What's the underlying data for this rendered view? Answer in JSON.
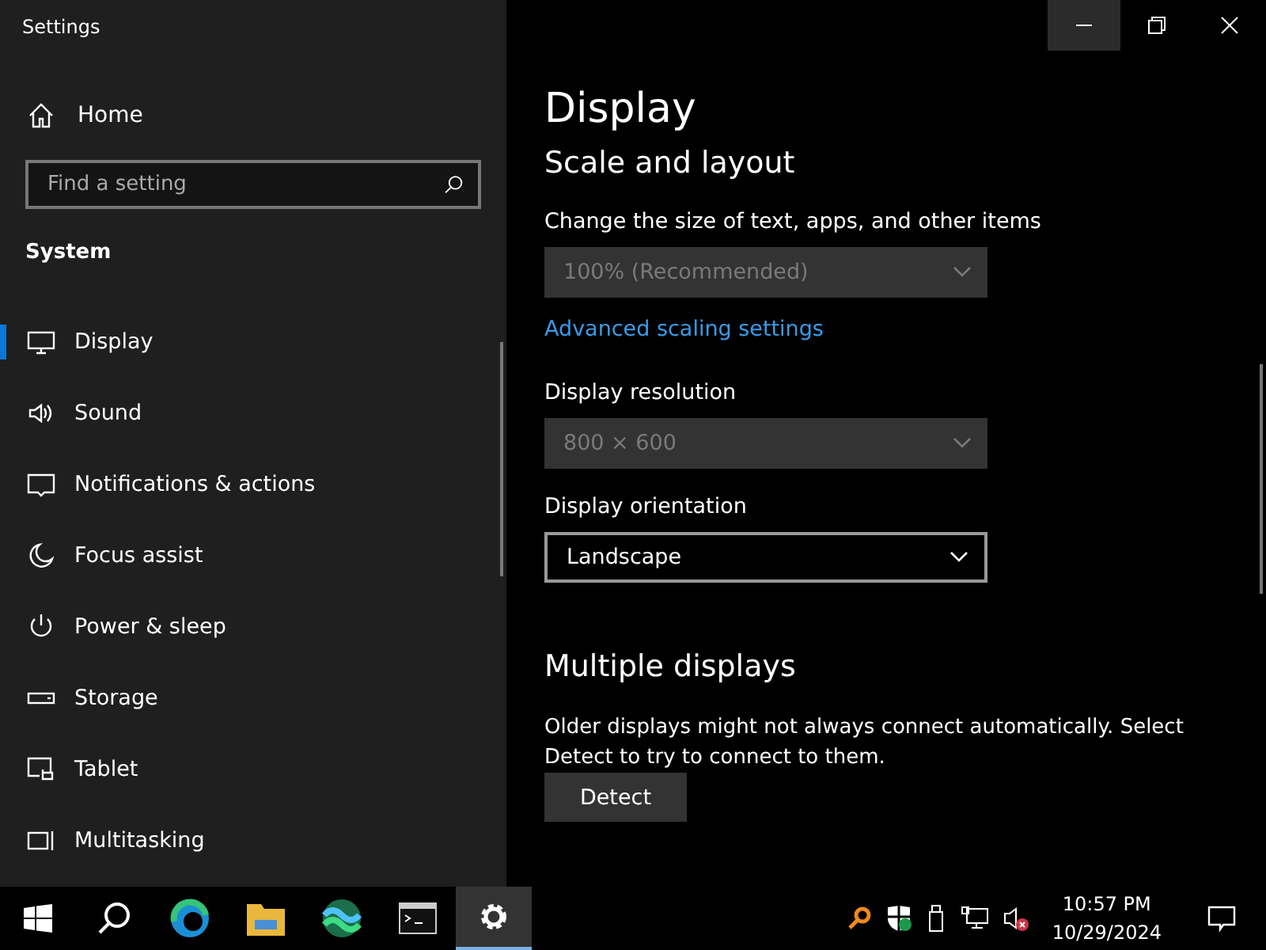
{
  "window": {
    "title": "Settings"
  },
  "sidebar": {
    "home": "Home",
    "search": {
      "placeholder": "Find a setting"
    },
    "section": "System",
    "items": [
      {
        "label": "Display",
        "kind": "display",
        "selected": true
      },
      {
        "label": "Sound",
        "kind": "sound",
        "selected": false
      },
      {
        "label": "Notifications & actions",
        "kind": "notifications",
        "selected": false
      },
      {
        "label": "Focus assist",
        "kind": "focus",
        "selected": false
      },
      {
        "label": "Power & sleep",
        "kind": "power",
        "selected": false
      },
      {
        "label": "Storage",
        "kind": "storage",
        "selected": false
      },
      {
        "label": "Tablet",
        "kind": "tablet",
        "selected": false
      },
      {
        "label": "Multitasking",
        "kind": "multitasking",
        "selected": false
      }
    ]
  },
  "content": {
    "title": "Display",
    "sections": [
      {
        "heading": "Scale and layout",
        "blocks": [
          {
            "kind": "dropdown",
            "label": "Change the size of text, apps, and other items",
            "value": "100% (Recommended)",
            "disabled": true
          },
          {
            "kind": "link",
            "text": "Advanced scaling settings"
          },
          {
            "kind": "dropdown",
            "label": "Display resolution",
            "value": "800 × 600",
            "disabled": true
          },
          {
            "kind": "dropdown",
            "label": "Display orientation",
            "value": "Landscape",
            "disabled": false
          }
        ]
      },
      {
        "heading": "Multiple displays",
        "blocks": [
          {
            "kind": "text",
            "text": "Older displays might not always connect automatically. Select Detect to try to connect to them."
          },
          {
            "kind": "button",
            "text": "Detect"
          }
        ]
      }
    ]
  },
  "taskbar": {
    "apps": [
      {
        "kind": "edge",
        "selected": false
      },
      {
        "kind": "folder",
        "selected": false
      },
      {
        "kind": "wave",
        "selected": false
      },
      {
        "kind": "terminal",
        "selected": false
      },
      {
        "kind": "settings",
        "selected": true
      }
    ],
    "time": "10:57 PM",
    "date": "10/29/2024"
  }
}
